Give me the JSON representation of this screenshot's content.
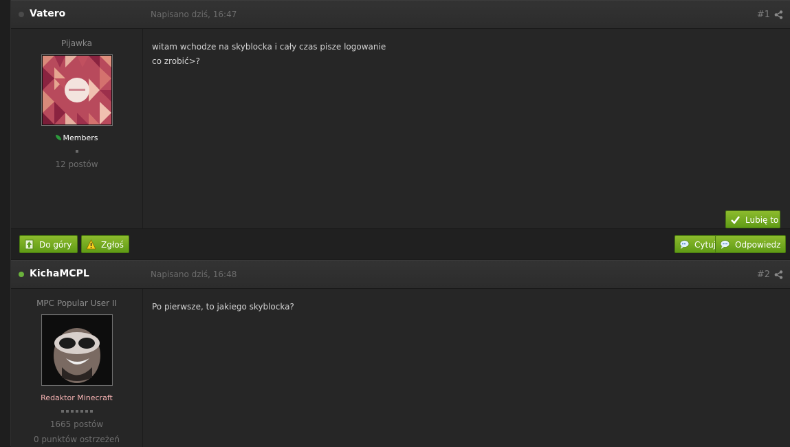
{
  "posts": [
    {
      "author": "Vatero",
      "status": "offline",
      "date": "Napisano dziś, 16:47",
      "number": "#1",
      "member_title": "Pijawka",
      "group": "Members",
      "pips": 1,
      "post_count": "12 postów",
      "content_lines": [
        "witam wchodze na skyblocka i cały czas pisze logowanie",
        "co zrobić>?"
      ],
      "like_label": "Lubię to"
    },
    {
      "author": "KichaMCPL",
      "status": "online",
      "date": "Napisano dziś, 16:48",
      "number": "#2",
      "member_title": "MPC Popular User II",
      "group": "Redaktor Minecraft",
      "pips": 7,
      "post_count": "1665 postów",
      "warnings": "0 punktów ostrzeżeń",
      "content_lines": [
        "Po pierwsze, to jakiego skyblocka?"
      ]
    }
  ],
  "post_actions": {
    "top_label": "Do góry",
    "report_label": "Zgłoś",
    "quote_label": "Cytuj",
    "reply_label": "Odpowiedz"
  },
  "colors": {
    "accent_green": "#6ea520",
    "online": "#6ab23c",
    "offline": "#4a4a4a",
    "staff_group": "#f5b2b2"
  },
  "icons": {
    "share": "share-icon",
    "like": "checkmark-icon",
    "top": "arrow-up-page-icon",
    "report": "warning-icon",
    "quote": "quote-bubble-icon",
    "reply": "reply-bubble-icon"
  }
}
